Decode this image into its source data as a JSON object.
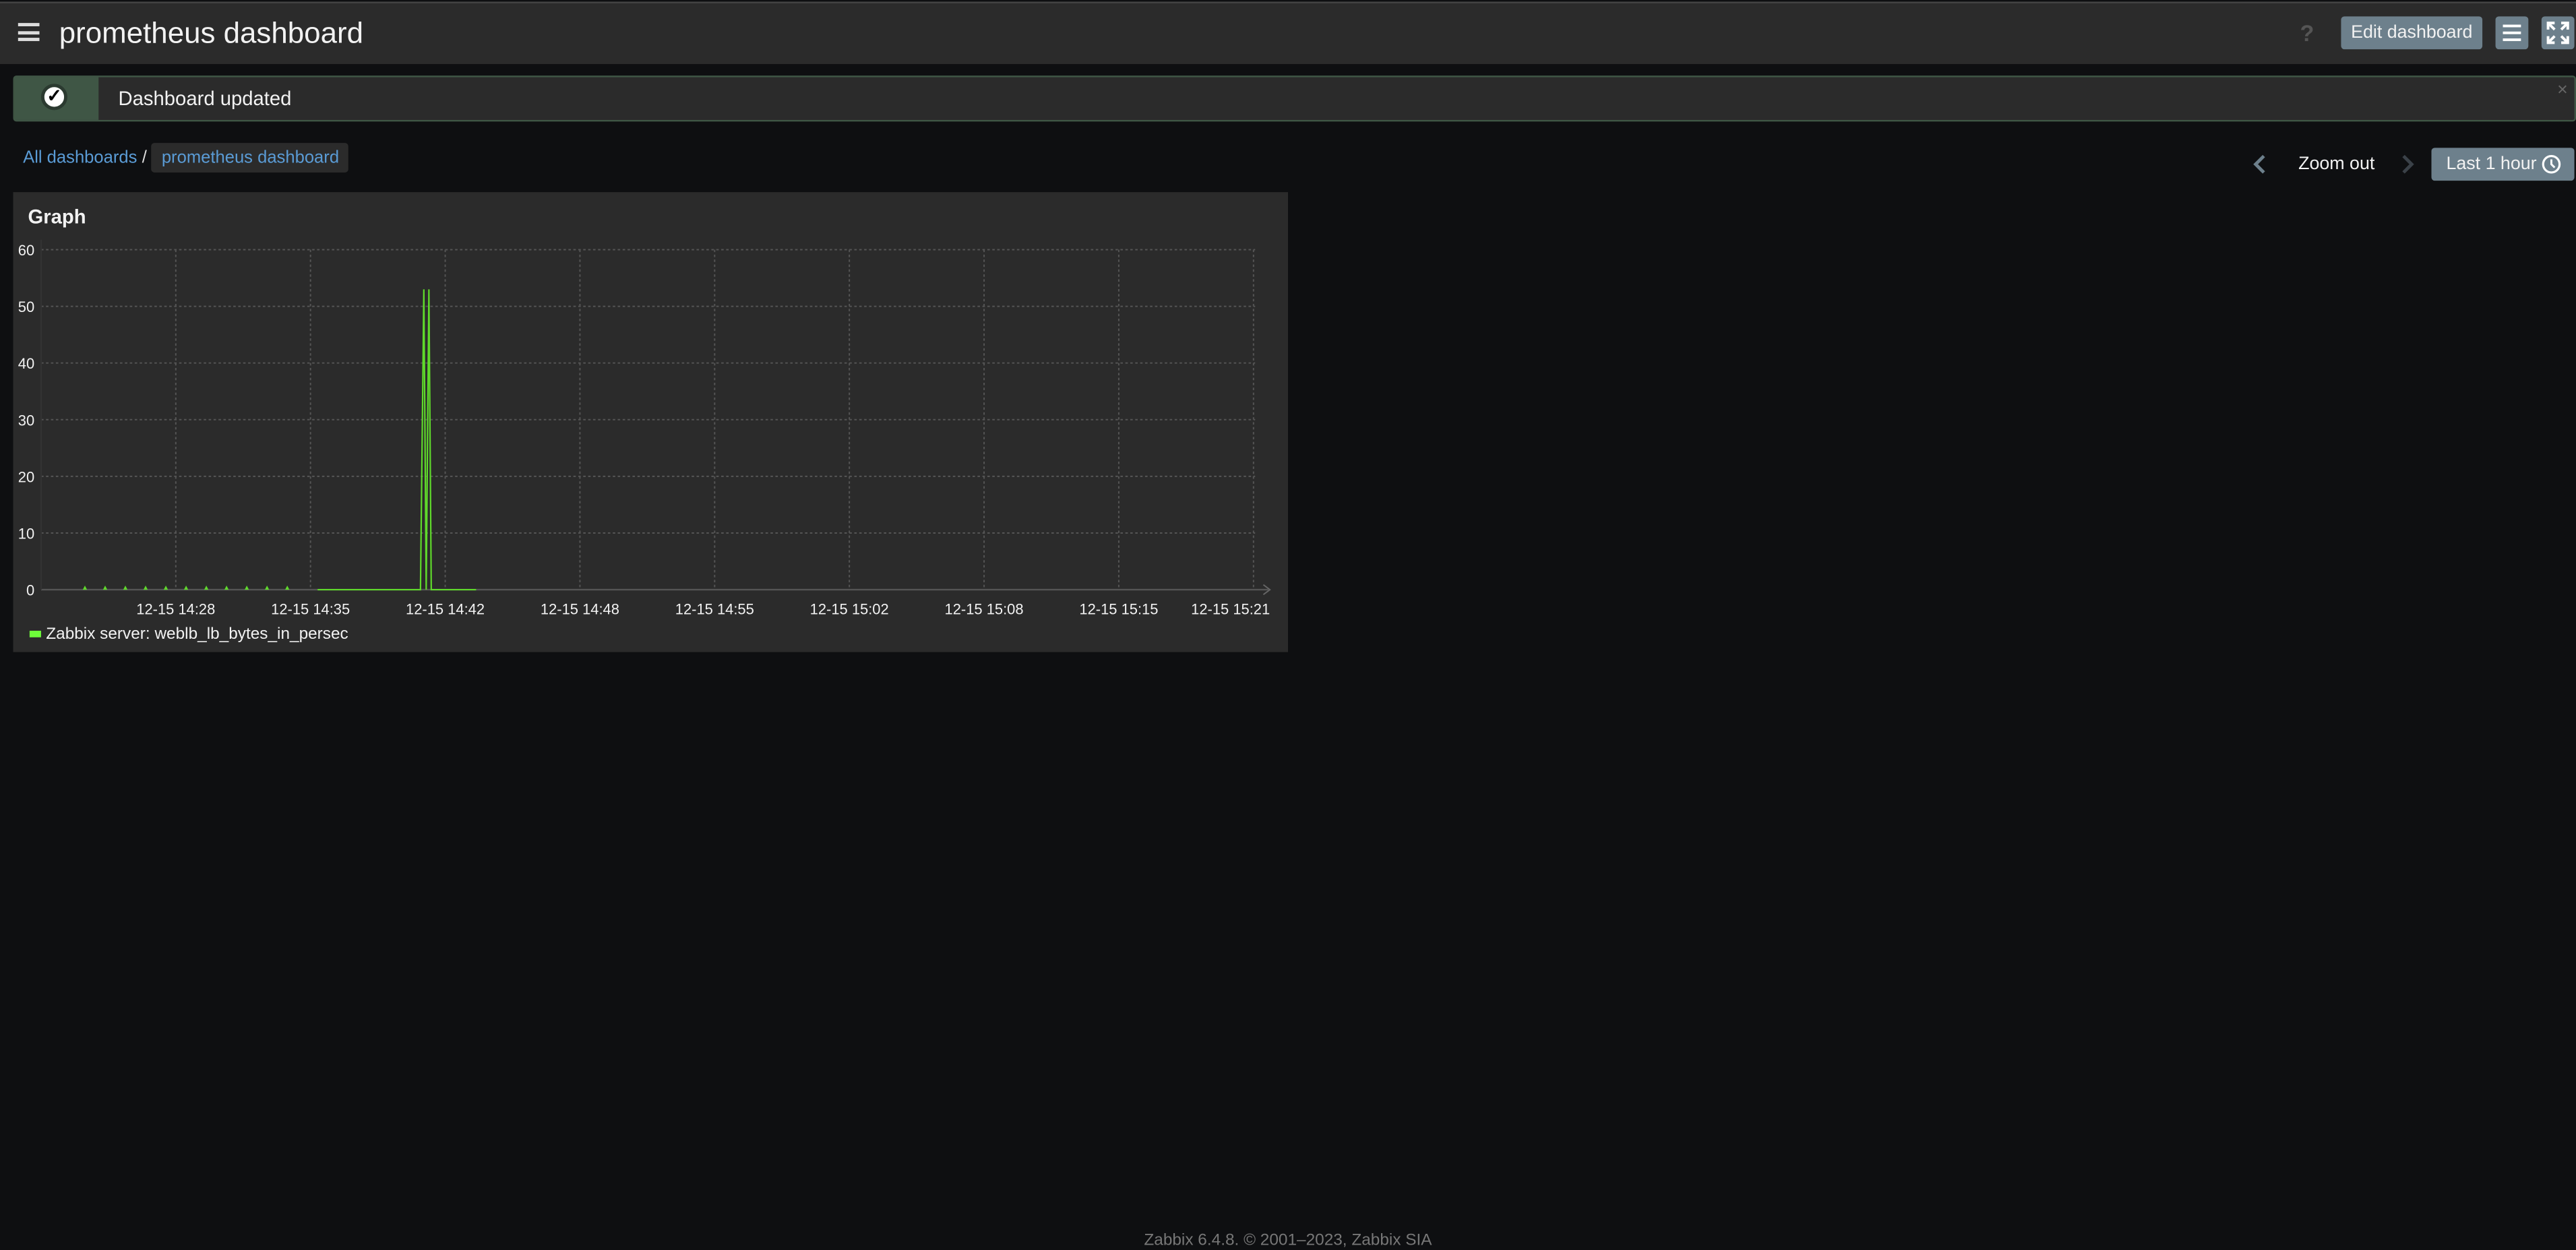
{
  "header": {
    "title": "prometheus dashboard",
    "help_icon": "?",
    "edit_label": "Edit dashboard"
  },
  "message": {
    "text": "Dashboard updated",
    "close": "×"
  },
  "breadcrumb": {
    "root": "All dashboards",
    "separator": "/",
    "current": "prometheus dashboard"
  },
  "timenav": {
    "zoom_out": "Zoom out",
    "range": "Last 1 hour"
  },
  "widget": {
    "title": "Graph"
  },
  "footer": {
    "text": "Zabbix 6.4.8. © 2001–2023, Zabbix SIA"
  },
  "colors": {
    "series": "#5fd92b",
    "legend": "#6efc3a",
    "button": "#6d808c",
    "success": "#3f5645"
  },
  "chart_data": {
    "type": "line",
    "title": "Graph",
    "x_range": [
      "14:21:20",
      "15:21:20"
    ],
    "ylim": [
      0,
      60
    ],
    "yticks": [
      0,
      10,
      20,
      30,
      40,
      50,
      60
    ],
    "xtick_labels": [
      "12-15 14:28",
      "12-15 14:35",
      "12-15 14:42",
      "12-15 14:48",
      "12-15 14:55",
      "12-15 15:02",
      "12-15 15:08",
      "12-15 15:15",
      "12-15 15:21"
    ],
    "grid": true,
    "legend_placement": "bottom-left",
    "series": [
      {
        "name": "Zabbix server: weblb_lb_bytes_in_persec",
        "points": [
          [
            "14:23:30",
            0
          ],
          [
            "14:24:30",
            0
          ],
          [
            "14:25:30",
            0
          ],
          [
            "14:26:30",
            0
          ],
          [
            "14:27:30",
            0
          ],
          [
            "14:28:30",
            0
          ],
          [
            "14:29:30",
            0
          ],
          [
            "14:30:30",
            0
          ],
          [
            "14:31:30",
            0
          ],
          [
            "14:32:30",
            0
          ],
          [
            "14:33:30",
            0
          ]
        ],
        "line": [
          [
            "14:35:00",
            0
          ],
          [
            "14:40:05",
            0
          ],
          [
            "14:40:15",
            53
          ],
          [
            "14:40:22",
            0
          ],
          [
            "14:40:30",
            53
          ],
          [
            "14:40:37",
            0
          ],
          [
            "14:42:50",
            0
          ]
        ]
      }
    ]
  }
}
